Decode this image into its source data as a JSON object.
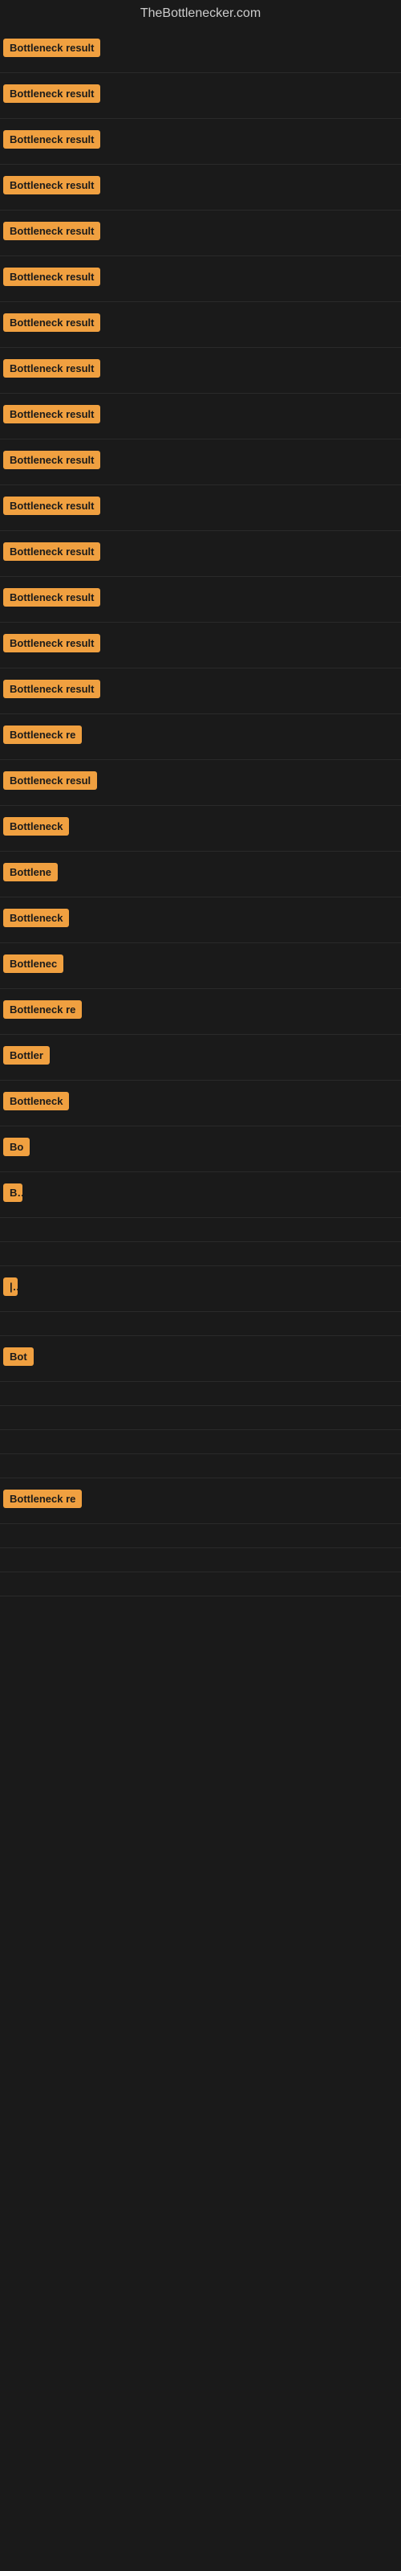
{
  "site": {
    "title": "TheBottlenecker.com"
  },
  "rows": [
    {
      "label": "Bottleneck result",
      "width": 150
    },
    {
      "label": "Bottleneck result",
      "width": 195
    },
    {
      "label": "Bottleneck result",
      "width": 180
    },
    {
      "label": "Bottleneck result",
      "width": 170
    },
    {
      "label": "Bottleneck result",
      "width": 185
    },
    {
      "label": "Bottleneck result",
      "width": 175
    },
    {
      "label": "Bottleneck result",
      "width": 198
    },
    {
      "label": "Bottleneck result",
      "width": 192
    },
    {
      "label": "Bottleneck result",
      "width": 188
    },
    {
      "label": "Bottleneck result",
      "width": 178
    },
    {
      "label": "Bottleneck result",
      "width": 191
    },
    {
      "label": "Bottleneck result",
      "width": 175
    },
    {
      "label": "Bottleneck result",
      "width": 168
    },
    {
      "label": "Bottleneck result",
      "width": 165
    },
    {
      "label": "Bottleneck result",
      "width": 155
    },
    {
      "label": "Bottleneck re",
      "width": 120
    },
    {
      "label": "Bottleneck resul",
      "width": 130
    },
    {
      "label": "Bottleneck",
      "width": 95
    },
    {
      "label": "Bottlene",
      "width": 75
    },
    {
      "label": "Bottleneck",
      "width": 95
    },
    {
      "label": "Bottlenec",
      "width": 85
    },
    {
      "label": "Bottleneck re",
      "width": 115
    },
    {
      "label": "Bottler",
      "width": 65
    },
    {
      "label": "Bottleneck",
      "width": 90
    },
    {
      "label": "Bo",
      "width": 28
    },
    {
      "label": "B",
      "width": 14
    },
    {
      "label": "",
      "width": 0
    },
    {
      "label": "",
      "width": 0
    },
    {
      "label": "|",
      "width": 8
    },
    {
      "label": "",
      "width": 0
    },
    {
      "label": "Bot",
      "width": 32
    },
    {
      "label": "",
      "width": 0
    },
    {
      "label": "",
      "width": 0
    },
    {
      "label": "",
      "width": 0
    },
    {
      "label": "",
      "width": 0
    },
    {
      "label": "Bottleneck re",
      "width": 115
    },
    {
      "label": "",
      "width": 0
    },
    {
      "label": "",
      "width": 0
    },
    {
      "label": "",
      "width": 0
    }
  ]
}
